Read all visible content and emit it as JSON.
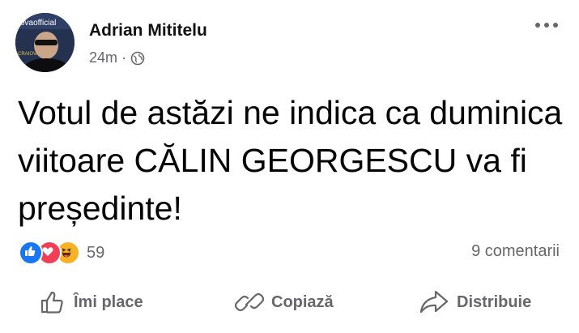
{
  "post": {
    "author": "Adrian Mititelu",
    "time": "24m",
    "separator": "·",
    "audience_icon": "globe-icon",
    "text": "Votul de astăzi ne indica ca duminica viitoare CĂLIN GEORGESCU va fi președinte!"
  },
  "avatar": {
    "banner_text": "ovaofficial",
    "side_text": "CRAIOVA"
  },
  "reactions": {
    "icons": [
      "like-icon",
      "love-icon",
      "haha-icon"
    ],
    "count": "59",
    "comments": "9 comentarii"
  },
  "actions": {
    "like": "Îmi place",
    "copy": "Copiază",
    "share": "Distribuie"
  },
  "colors": {
    "like": "#1877f2",
    "love": "#f33e58",
    "haha": "#f7b125",
    "secondary_text": "#65676b"
  }
}
